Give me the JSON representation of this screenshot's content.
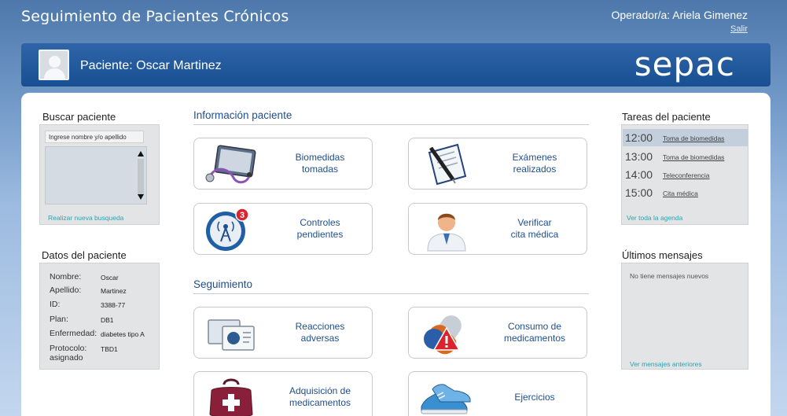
{
  "app_title": "Seguimiento de Pacientes Crónicos",
  "operator_label": "Operador/a: Ariela Gimenez",
  "logout_label": "Salir",
  "patient_banner": "Paciente: Oscar Martinez",
  "brand": "sepac",
  "search": {
    "title": "Buscar paciente",
    "placeholder": "Ingrese nombre y/o apellido",
    "new_search_link": "Realizar nueva busqueda"
  },
  "patient_data": {
    "title": "Datos del paciente",
    "fields": [
      {
        "label": "Nombre:",
        "value": "Oscar"
      },
      {
        "label": "Apellido:",
        "value": "Martinez"
      },
      {
        "label": "ID:",
        "value": "3388-77"
      },
      {
        "label": "Plan:",
        "value": "DB1"
      },
      {
        "label": "Enfermedad:",
        "value": "diabetes tipo A"
      },
      {
        "label": "Protocolo:\nasignado",
        "value": "TBD1"
      }
    ]
  },
  "info_section": {
    "title": "Información paciente",
    "tiles": [
      {
        "label": "Biomedidas\ntomadas",
        "icon": "tablet-stethoscope-icon"
      },
      {
        "label": "Exámenes\nrealizados",
        "icon": "document-pen-icon"
      },
      {
        "label": "Controles\npendientes",
        "icon": "antenna-notification-icon",
        "badge": "3"
      },
      {
        "label": "Verificar\ncita médica",
        "icon": "doctor-icon"
      }
    ]
  },
  "follow_section": {
    "title": "Seguimiento",
    "tiles": [
      {
        "label": "Reacciones\nadversas",
        "icon": "adverse-reactions-icon"
      },
      {
        "label": "Consumo de\nmedicamentos",
        "icon": "pill-warning-icon"
      },
      {
        "label": "Adquisición de\nmedicamentos",
        "icon": "medical-bag-icon"
      },
      {
        "label": "Ejercicios",
        "icon": "sneakers-icon"
      }
    ]
  },
  "tasks": {
    "title": "Tareas del paciente",
    "items": [
      {
        "time": "12:00",
        "name": "Toma de biomedidas",
        "active": true
      },
      {
        "time": "13:00",
        "name": "Toma de biomedidas",
        "active": false
      },
      {
        "time": "14:00",
        "name": "Teleconferencia",
        "active": false
      },
      {
        "time": "15:00",
        "name": "Cita médica",
        "active": false
      }
    ],
    "agenda_link": "Ver toda la agenda"
  },
  "messages": {
    "title": "Últimos mensajes",
    "empty_text": "No tiene mensajes nuevos",
    "older_link": "Ver mensajes anteriores"
  },
  "colors": {
    "header_band": "#1f57a0",
    "section_title": "#1f4f8c",
    "link": "#26a5b0",
    "badge": "#d9232d"
  }
}
